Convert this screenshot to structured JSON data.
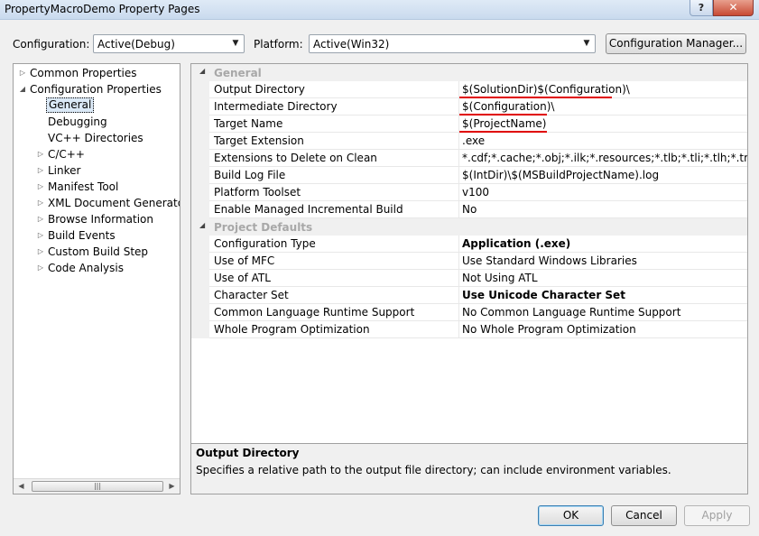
{
  "window": {
    "title": "PropertyMacroDemo Property Pages",
    "help_glyph": "?",
    "close_glyph": "✕"
  },
  "toolbar": {
    "configuration_label": "Configuration:",
    "configuration_value": "Active(Debug)",
    "platform_label": "Platform:",
    "platform_value": "Active(Win32)",
    "config_manager_label": "Configuration Manager..."
  },
  "tree": {
    "items": [
      {
        "label": "Common Properties"
      },
      {
        "label": "Configuration Properties"
      },
      {
        "label": "General"
      },
      {
        "label": "Debugging"
      },
      {
        "label": "VC++ Directories"
      },
      {
        "label": "C/C++"
      },
      {
        "label": "Linker"
      },
      {
        "label": "Manifest Tool"
      },
      {
        "label": "XML Document Generator"
      },
      {
        "label": "Browse Information"
      },
      {
        "label": "Build Events"
      },
      {
        "label": "Custom Build Step"
      },
      {
        "label": "Code Analysis"
      }
    ],
    "selected": "General"
  },
  "grid": {
    "categories": [
      {
        "name": "General",
        "rows": [
          {
            "name": "Output Directory",
            "value": "$(SolutionDir)$(Configuration)\\"
          },
          {
            "name": "Intermediate Directory",
            "value": "$(Configuration)\\"
          },
          {
            "name": "Target Name",
            "value": "$(ProjectName)"
          },
          {
            "name": "Target Extension",
            "value": ".exe"
          },
          {
            "name": "Extensions to Delete on Clean",
            "value": "*.cdf;*.cache;*.obj;*.ilk;*.resources;*.tlb;*.tli;*.tlh;*.tmp;*.rsp;*"
          },
          {
            "name": "Build Log File",
            "value": "$(IntDir)\\$(MSBuildProjectName).log"
          },
          {
            "name": "Platform Toolset",
            "value": "v100"
          },
          {
            "name": "Enable Managed Incremental Build",
            "value": "No"
          }
        ]
      },
      {
        "name": "Project Defaults",
        "rows": [
          {
            "name": "Configuration Type",
            "value": "Application (.exe)",
            "bold": true
          },
          {
            "name": "Use of MFC",
            "value": "Use Standard Windows Libraries"
          },
          {
            "name": "Use of ATL",
            "value": "Not Using ATL"
          },
          {
            "name": "Character Set",
            "value": "Use Unicode Character Set",
            "bold": true
          },
          {
            "name": "Common Language Runtime Support",
            "value": "No Common Language Runtime Support"
          },
          {
            "name": "Whole Program Optimization",
            "value": "No Whole Program Optimization"
          }
        ]
      }
    ],
    "underline_color": "#e00000"
  },
  "description": {
    "title": "Output Directory",
    "text": "Specifies a relative path to the output file directory; can include environment variables."
  },
  "buttons": {
    "ok": "OK",
    "cancel": "Cancel",
    "apply": "Apply"
  }
}
